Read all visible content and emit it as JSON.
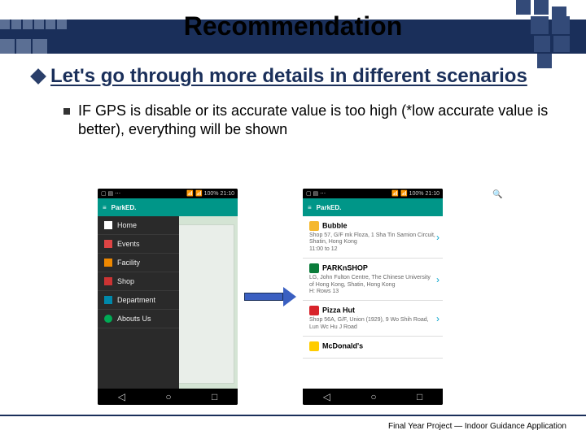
{
  "title": "Recommendation",
  "heading": "Let's go through more details in different scenarios",
  "bullet": "IF GPS is disable or its accurate value is too high (*low accurate value is better), everything will be shown",
  "footer": "Final Year Project — Indoor Guidance Application",
  "phone": {
    "status_time": "21:10",
    "app_name": "ParkED.",
    "nav_items": [
      "Home",
      "Events",
      "Facility",
      "Shop",
      "Department",
      "Abouts Us"
    ],
    "nav_buttons": [
      "◁",
      "○",
      "□"
    ]
  },
  "list": {
    "items": [
      {
        "name": "Bubble",
        "addr": "Shop 57, G/F mk Floza, 1 Sha Tin Samion Circuit, Shatin, Hong Kong",
        "hours": "11:00 to 12"
      },
      {
        "name": "PARKnSHOP",
        "addr": "LG, John Fulton Centre, The Chinese University of Hong Kong, Shatin, Hong Kong",
        "hours": "H: Rows 13"
      },
      {
        "name": "Pizza Hut",
        "addr": "Shop 56A, G/F, Union (1929), 9 Wo Shih Road, Lun Wc Hu J Road",
        "hours": ""
      },
      {
        "name": "McDonald's",
        "addr": "",
        "hours": ""
      }
    ]
  }
}
